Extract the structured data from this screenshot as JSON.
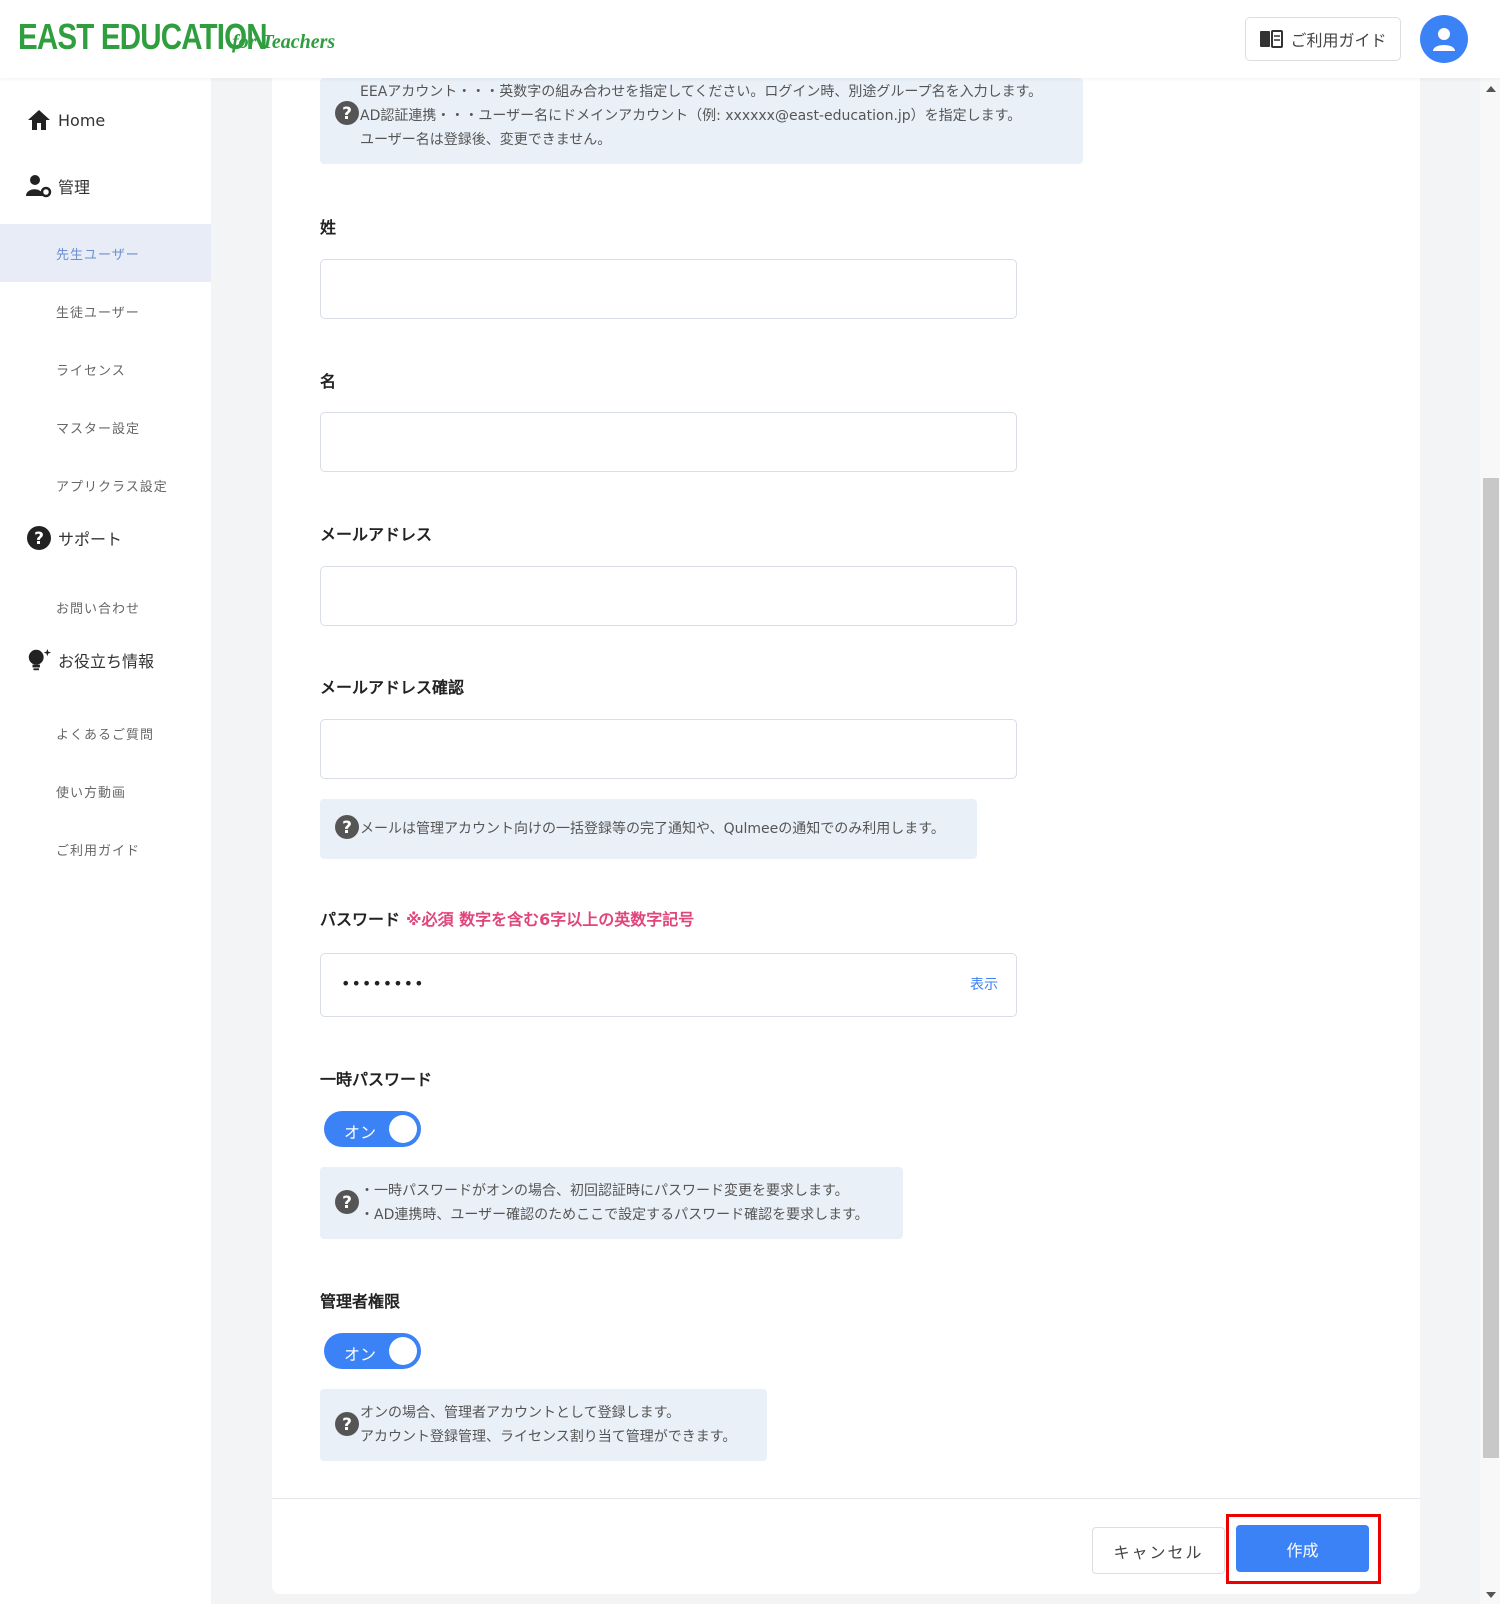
{
  "header": {
    "logo_main": "EAST EDUCATION",
    "logo_sub": "for Teachers",
    "guide_button": "ご利用ガイド",
    "guide_icon": "book-icon",
    "avatar_icon": "user-icon"
  },
  "sidebar": {
    "home": "Home",
    "manage": "管理",
    "manage_items": [
      "先生ユーザー",
      "生徒ユーザー",
      "ライセンス",
      "マスター設定",
      "アプリクラス設定"
    ],
    "support": "サポート",
    "support_items": [
      "お問い合わせ"
    ],
    "info": "お役立ち情報",
    "info_items": [
      "よくあるご質問",
      "使い方動画",
      "ご利用ガイド"
    ]
  },
  "form": {
    "username_help": [
      "EEAアカウント・・・英数字の組み合わせを指定してください。ログイン時、別途グループ名を入力します。",
      "AD認証連携・・・ユーザー名にドメインアカウント（例: xxxxxx@east-education.jp）を指定します。",
      "ユーザー名は登録後、変更できません。"
    ],
    "last_name_label": "姓",
    "last_name_value": "",
    "first_name_label": "名",
    "first_name_value": "",
    "email_label": "メールアドレス",
    "email_value": "",
    "email_confirm_label": "メールアドレス確認",
    "email_confirm_value": "",
    "email_help": "メールは管理アカウント向けの一括登録等の完了通知や、Qulmeeの通知でのみ利用します。",
    "password_label": "パスワード",
    "password_requirement": "※必須 数字を含む6字以上の英数字記号",
    "password_value": "••••••••",
    "password_show": "表示",
    "temp_password_label": "一時パスワード",
    "temp_password_toggle": "オン",
    "temp_password_help": [
      "・一時パスワードがオンの場合、初回認証時にパスワード変更を要求します。",
      "・AD連携時、ユーザー確認のためここで設定するパスワード確認を要求します。"
    ],
    "admin_label": "管理者権限",
    "admin_toggle": "オン",
    "admin_help": [
      "オンの場合、管理者アカウントとして登録します。",
      "アカウント登録管理、ライセンス割り当て管理ができます。"
    ]
  },
  "actions": {
    "cancel": "キャンセル",
    "create": "作成"
  },
  "colors": {
    "brand_green": "#2e9e3e",
    "accent_blue": "#3b82f6",
    "required_pink": "#e0457b",
    "highlight_red": "#ee0000"
  }
}
